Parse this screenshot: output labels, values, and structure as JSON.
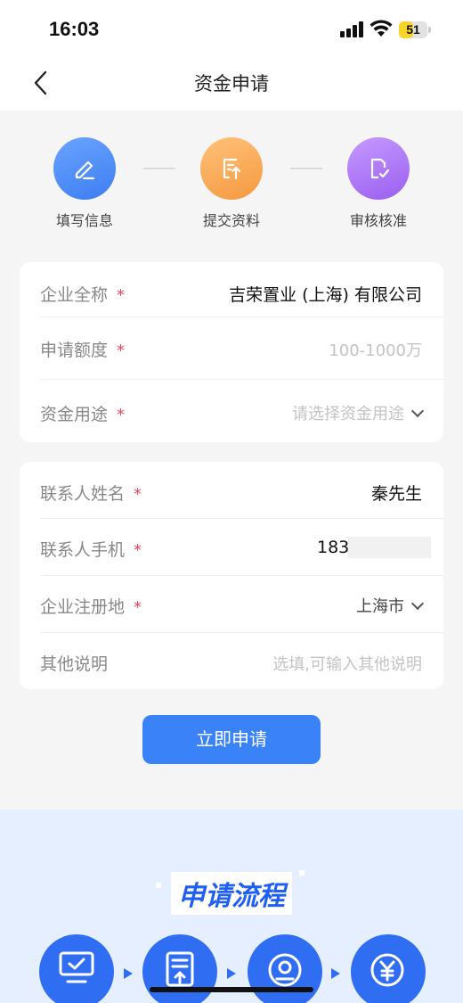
{
  "status_bar": {
    "time": "16:03",
    "battery_level": "51",
    "icons": [
      "signal-icon",
      "wifi-icon",
      "battery-icon"
    ]
  },
  "nav": {
    "title": "资金申请",
    "back_icon": "chevron-left-icon"
  },
  "steps": [
    {
      "label": "填写信息",
      "icon": "edit-icon",
      "color": "#4a8af4"
    },
    {
      "label": "提交资料",
      "icon": "upload-doc-icon",
      "color": "#f5a15a"
    },
    {
      "label": "审核核准",
      "icon": "approve-doc-icon",
      "color": "#a86ef0"
    }
  ],
  "form_company": {
    "company_name": {
      "label": "企业全称",
      "required": "*",
      "value": "吉荣置业 (上海) 有限公司"
    },
    "amount": {
      "label": "申请额度",
      "required": "*",
      "placeholder": "100-1000万"
    },
    "purpose": {
      "label": "资金用途",
      "required": "*",
      "placeholder": "请选择资金用途"
    }
  },
  "form_contact": {
    "contact_name": {
      "label": "联系人姓名",
      "required": "*",
      "value": "秦先生"
    },
    "contact_phone": {
      "label": "联系人手机",
      "required": "*",
      "value": "183"
    },
    "region": {
      "label": "企业注册地",
      "required": "*",
      "value": "上海市"
    },
    "notes": {
      "label": "其他说明",
      "placeholder": "选填,可输入其他说明"
    }
  },
  "submit_label": "立即申请",
  "process": {
    "title": "申请流程",
    "icons": [
      "monitor-icon",
      "upload-doc-icon",
      "user-badge-icon",
      "yuan-coin-icon"
    ]
  },
  "colors": {
    "accent": "#3a82f7",
    "required": "#e64a5f",
    "process_bg": "#e6efff"
  }
}
